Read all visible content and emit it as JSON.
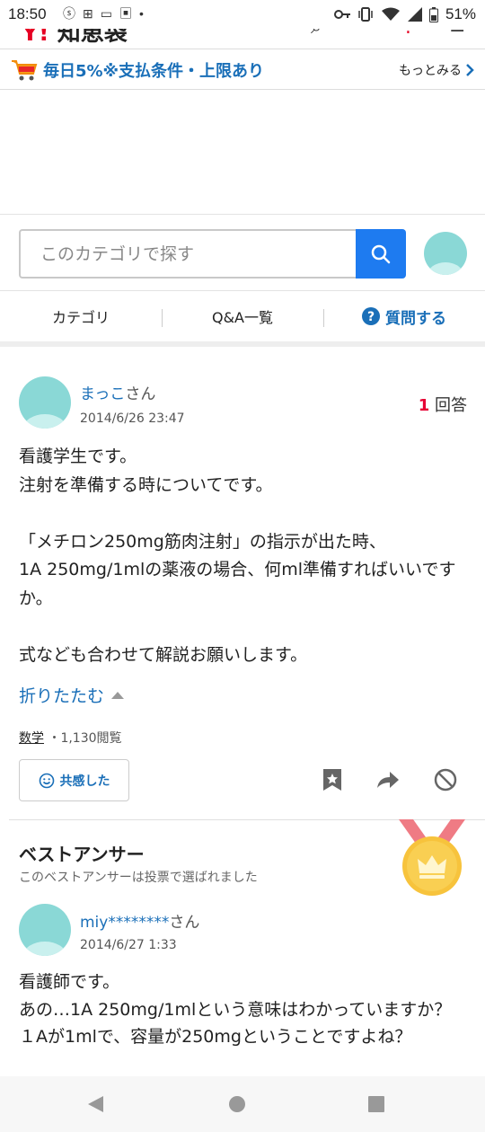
{
  "status_bar": {
    "time": "18:50",
    "battery": "51%",
    "notification_icons": [
      "notification-icon",
      "nfc-icon",
      "sim-icon",
      "app-icon",
      "dot-icon"
    ],
    "system_icons": [
      "key-icon",
      "vibrate-icon",
      "wifi-icon",
      "signal-icon",
      "battery-icon"
    ]
  },
  "header": {
    "logo_text": "知恵袋"
  },
  "promo": {
    "text": "毎日5%※支払条件・上限あり",
    "more_label": "もっとみる"
  },
  "search": {
    "placeholder": "このカテゴリで探す"
  },
  "tabs": {
    "category": "カテゴリ",
    "qa_list": "Q&A一覧",
    "ask": "質問する"
  },
  "question": {
    "username": "まっこ",
    "honorific": "さん",
    "date": "2014/6/26 23:47",
    "answer_count": "1",
    "answer_label": "回答",
    "body": "看護学生です。\n注射を準備する時についてです。\n\n「メチロン250mg筋肉注射」の指示が出た時、\n1A 250mg/1mlの薬液の場合、何ml準備すればいいですか。\n\n式なども合わせて解説お願いします。",
    "collapse_label": "折りたたむ",
    "category": "数学",
    "views": "・1,130閲覧",
    "empathy_label": "共感した"
  },
  "best_answer": {
    "title": "ベストアンサー",
    "subtitle": "このベストアンサーは投票で選ばれました",
    "username": "miy********",
    "honorific": "さん",
    "date": "2014/6/27 1:33",
    "body": "看護師です。\nあの…1A 250mg/1mlという意味はわかっていますか？\n１Aが1mlで、容量が250mgということですよね？"
  },
  "colors": {
    "link_blue": "#1a6fb8",
    "search_button": "#1e7bf0",
    "answer_count_red": "#e60033",
    "avatar_teal": "#8ad8d6",
    "medal_gold": "#f7c33c",
    "medal_ribbon": "#ef7b84"
  }
}
